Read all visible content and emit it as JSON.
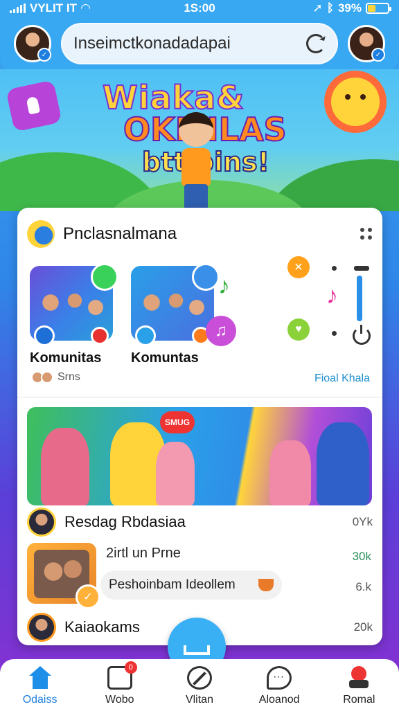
{
  "status_bar": {
    "carrier": "VYLIT IT",
    "time": "1S:00",
    "battery": "39%"
  },
  "header": {
    "search_text": "Inseimctkonadadapai"
  },
  "banner": {
    "line1": "Wiaka&",
    "line2": "OKMILAS",
    "line3": "btt pins!"
  },
  "card": {
    "title": "Pnclasnalmana",
    "communities": [
      {
        "name": "Komunitas"
      },
      {
        "name": "Komuntas"
      }
    ],
    "sub_label": "Srns",
    "right_link": "Fioal Khala"
  },
  "promo": {
    "tag": "SMUG"
  },
  "rows": {
    "row1_label": "Resdag Rbdasiaa",
    "row1_count": "0Yk",
    "feed_title": "2irtl un Prne",
    "feed_count1": "30k",
    "pill_text": "Peshoinbam Ideollem",
    "feed_count2": "6.k",
    "row3_label": "Kaiaokams",
    "row3_count": "20k"
  },
  "nav": {
    "items": [
      {
        "label": "Odaiss",
        "icon": "home-icon"
      },
      {
        "label": "Wobo",
        "icon": "inbox-icon",
        "badge": "0"
      },
      {
        "label": "Vlitan",
        "icon": "compass-icon"
      },
      {
        "label": "Aloanod",
        "icon": "chat-icon"
      },
      {
        "label": "Romal",
        "icon": "joystick-icon"
      }
    ]
  },
  "colors": {
    "accent": "#1e8fe8",
    "header": "#39a8f2",
    "background_top": "#3aa7f0",
    "background_bottom": "#8a2fd0"
  }
}
